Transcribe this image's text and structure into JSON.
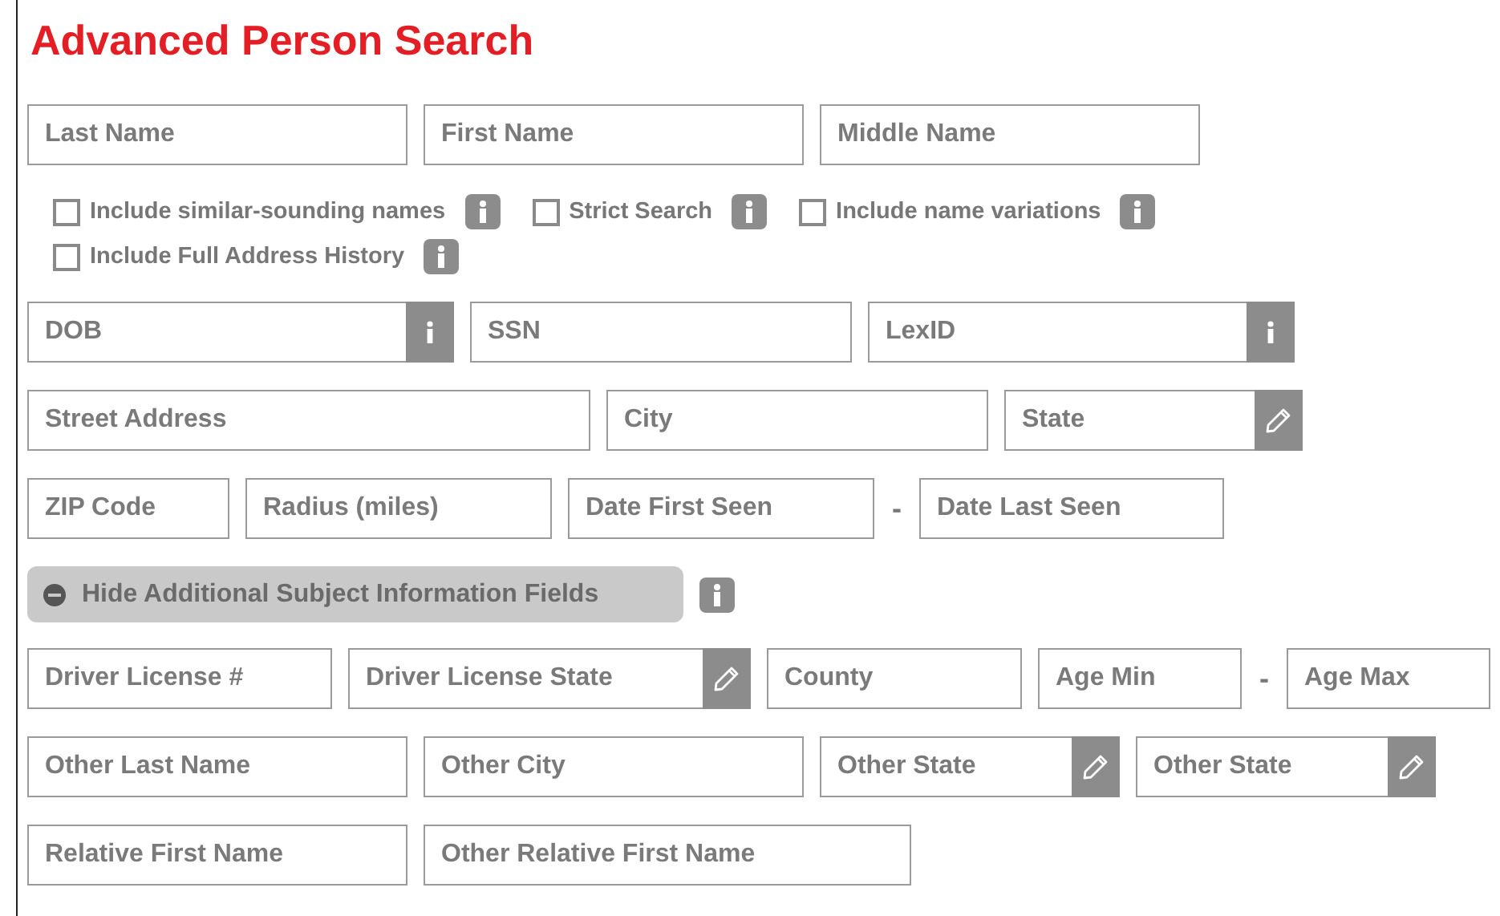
{
  "title": "Advanced Person Search",
  "name_fields": [
    {
      "placeholder": "Last Name",
      "kind": "text"
    },
    {
      "placeholder": "First Name",
      "kind": "text"
    },
    {
      "placeholder": "Middle Name",
      "kind": "text"
    }
  ],
  "options": [
    {
      "label": "Include similar-sounding names",
      "checked": false
    },
    {
      "label": "Strict Search",
      "checked": false
    },
    {
      "label": "Include name variations",
      "checked": false
    },
    {
      "label": "Include Full Address History",
      "checked": false
    }
  ],
  "rows": [
    [
      {
        "placeholder": "DOB",
        "kind": "info"
      },
      {
        "placeholder": "SSN",
        "kind": "text"
      },
      {
        "placeholder": "LexID",
        "kind": "info"
      }
    ],
    [
      {
        "placeholder": "Street Address",
        "kind": "text"
      },
      {
        "placeholder": "City",
        "kind": "text"
      },
      {
        "placeholder": "State",
        "kind": "select"
      }
    ],
    [
      {
        "placeholder": "ZIP Code",
        "kind": "text"
      },
      {
        "placeholder": "Radius (miles)",
        "kind": "text"
      },
      {
        "placeholder": "Date First Seen",
        "kind": "text"
      },
      {
        "text": "-",
        "kind": "separator"
      },
      {
        "placeholder": "Date Last Seen",
        "kind": "text"
      }
    ]
  ],
  "toggle": {
    "label": "Hide Additional Subject Information Fields",
    "expanded": true
  },
  "additional_rows": [
    [
      {
        "placeholder": "Driver License #",
        "kind": "text"
      },
      {
        "placeholder": "Driver License State",
        "kind": "select"
      },
      {
        "placeholder": "County",
        "kind": "text"
      },
      {
        "placeholder": "Age Min",
        "kind": "text"
      },
      {
        "text": "-",
        "kind": "separator"
      },
      {
        "placeholder": "Age Max",
        "kind": "text"
      }
    ],
    [
      {
        "placeholder": "Other Last Name",
        "kind": "text"
      },
      {
        "placeholder": "Other City",
        "kind": "text"
      },
      {
        "placeholder": "Other State",
        "kind": "select"
      },
      {
        "placeholder": "Other State",
        "kind": "select"
      }
    ],
    [
      {
        "placeholder": "Relative First Name",
        "kind": "text"
      },
      {
        "placeholder": "Other Relative First Name",
        "kind": "text"
      }
    ]
  ]
}
